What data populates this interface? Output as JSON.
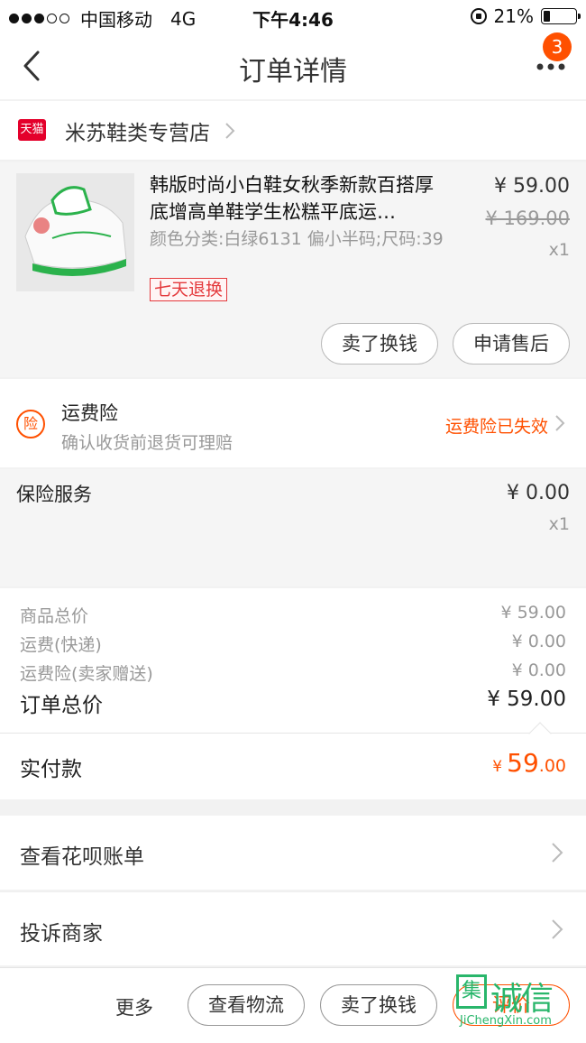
{
  "status_bar": {
    "carrier": "中国移动",
    "network": "4G",
    "time": "下午4:46",
    "battery": "21%",
    "battery_level": 0.21
  },
  "nav": {
    "title": "订单详情",
    "badge_count": "3"
  },
  "store": {
    "logo_text": "天猫",
    "name": "米苏鞋类专营店"
  },
  "product": {
    "title": "韩版时尚小白鞋女秋季新款百搭厚底增高单鞋学生松糕平底运…",
    "spec": "颜色分类:白绿6131 偏小半码;尺码:39",
    "tag": "七天退换",
    "price": "¥ 59.00",
    "original_price": "¥ 169.00",
    "qty": "x1",
    "buttons": [
      "卖了换钱",
      "申请售后"
    ]
  },
  "shipping_insurance": {
    "title": "运费险",
    "desc": "确认收货前退货可理赔",
    "status": "运费险已失效",
    "icon_text": "险"
  },
  "insurance_service": {
    "title": "保险服务",
    "price": "¥ 0.00",
    "qty": "x1"
  },
  "summary": {
    "rows": [
      {
        "label": "商品总价",
        "value": "¥ 59.00"
      },
      {
        "label": "运费(快递)",
        "value": "¥ 0.00"
      },
      {
        "label": "运费险(卖家赠送)",
        "value": "¥ 0.00"
      }
    ],
    "total_label": "订单总价",
    "total_value": "¥ 59.00"
  },
  "paid": {
    "label": "实付款",
    "symbol": "¥",
    "amount_int": "59",
    "amount_dec": ".00"
  },
  "links": [
    "查看花呗账单",
    "投诉商家"
  ],
  "bottom": {
    "more": "更多",
    "buttons": [
      "查看物流",
      "卖了换钱",
      "评价"
    ]
  },
  "watermark": {
    "box": "集",
    "text": "诚信",
    "sub": "JiChengXin.com"
  },
  "colors": {
    "accent": "#ff5000",
    "tmall_red": "#e4002b",
    "watermark_green": "#29b66b"
  }
}
